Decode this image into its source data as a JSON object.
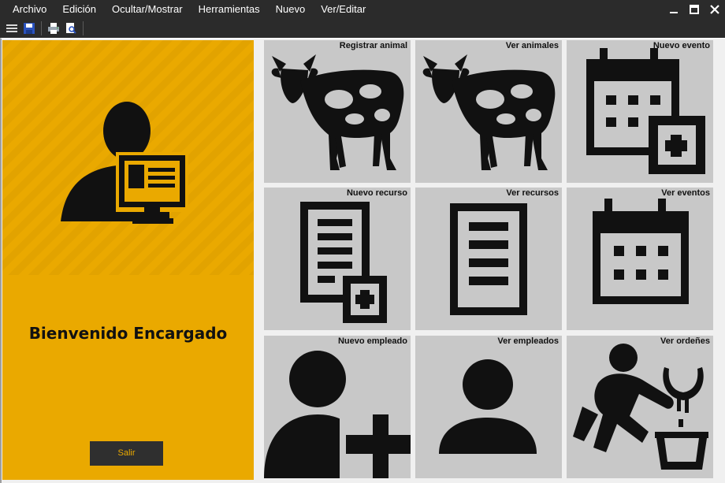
{
  "menubar": {
    "items": [
      "Archivo",
      "Edición",
      "Ocultar/Mostrar",
      "Herramientas",
      "Nuevo",
      "Ver/Editar"
    ]
  },
  "window_controls": [
    "minimize-icon",
    "maximize-icon",
    "close-icon"
  ],
  "toolbar": {
    "icons": [
      "menu-icon",
      "save-icon",
      "print-icon",
      "print-preview-icon"
    ]
  },
  "side_panel": {
    "welcome_text": "Bienvenido Encargado",
    "exit_label": "Salir",
    "icon": "user-computer-icon",
    "accent_color": "#eaa900"
  },
  "tiles": [
    {
      "label": "Registrar animal",
      "icon": "cow-icon"
    },
    {
      "label": "Ver animales",
      "icon": "cow-icon"
    },
    {
      "label": "Nuevo evento",
      "icon": "calendar-add-icon"
    },
    {
      "label": "Nuevo recurso",
      "icon": "document-add-icon"
    },
    {
      "label": "Ver recursos",
      "icon": "document-icon"
    },
    {
      "label": "Ver eventos",
      "icon": "calendar-icon"
    },
    {
      "label": "Nuevo empleado",
      "icon": "user-add-icon"
    },
    {
      "label": "Ver empleados",
      "icon": "user-icon"
    },
    {
      "label": "Ver ordeñes",
      "icon": "milking-icon"
    }
  ]
}
